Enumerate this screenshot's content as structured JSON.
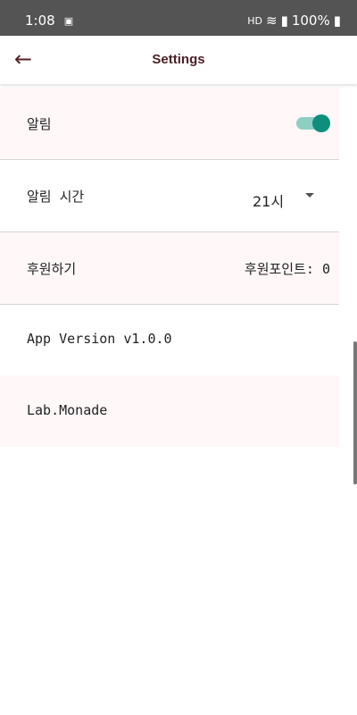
{
  "status": {
    "time": "1:08",
    "battery": "100%",
    "network_badge": "HD"
  },
  "appbar": {
    "title": "Settings",
    "back_icon": "arrow-back-icon"
  },
  "settings": {
    "notification": {
      "label": "알림",
      "enabled": true
    },
    "notification_time": {
      "label": "알림 시간",
      "value": "21시"
    },
    "donate": {
      "label": "후원하기",
      "points": "후원포인트: 0"
    },
    "version": {
      "label": "App Version v1.0.0"
    },
    "company": {
      "label": "Lab.Monade"
    }
  },
  "colors": {
    "accent": "#0d8f7b",
    "title": "#4a1f27",
    "row_bg": "#fff7f8"
  }
}
